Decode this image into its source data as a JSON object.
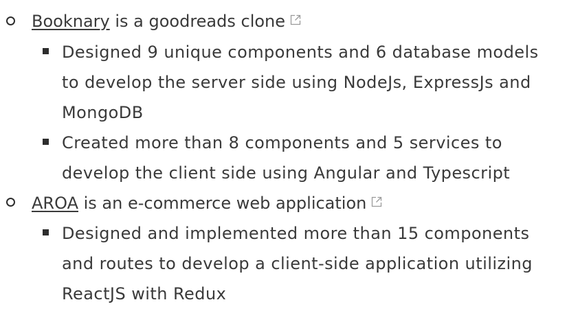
{
  "projects": [
    {
      "link_text": "Booknary",
      "description": " is a goodreads clone",
      "icon": "external-link-icon",
      "details": [
        {
          "lines": [
            "Designed 9 unique components and 6 database models",
            "to develop the server side using NodeJs, ExpressJs and",
            "MongoDB"
          ]
        },
        {
          "lines": [
            "Created more than 8 components and 5 services to",
            "develop the client side using Angular and Typescript"
          ]
        }
      ]
    },
    {
      "link_text": "AROA",
      "description": " is an e-commerce web application",
      "icon": "external-link-icon",
      "details": [
        {
          "lines": [
            "Designed and implemented more than 15 components",
            "and routes to develop a client-side application utilizing",
            "ReactJS with Redux"
          ]
        }
      ]
    }
  ]
}
